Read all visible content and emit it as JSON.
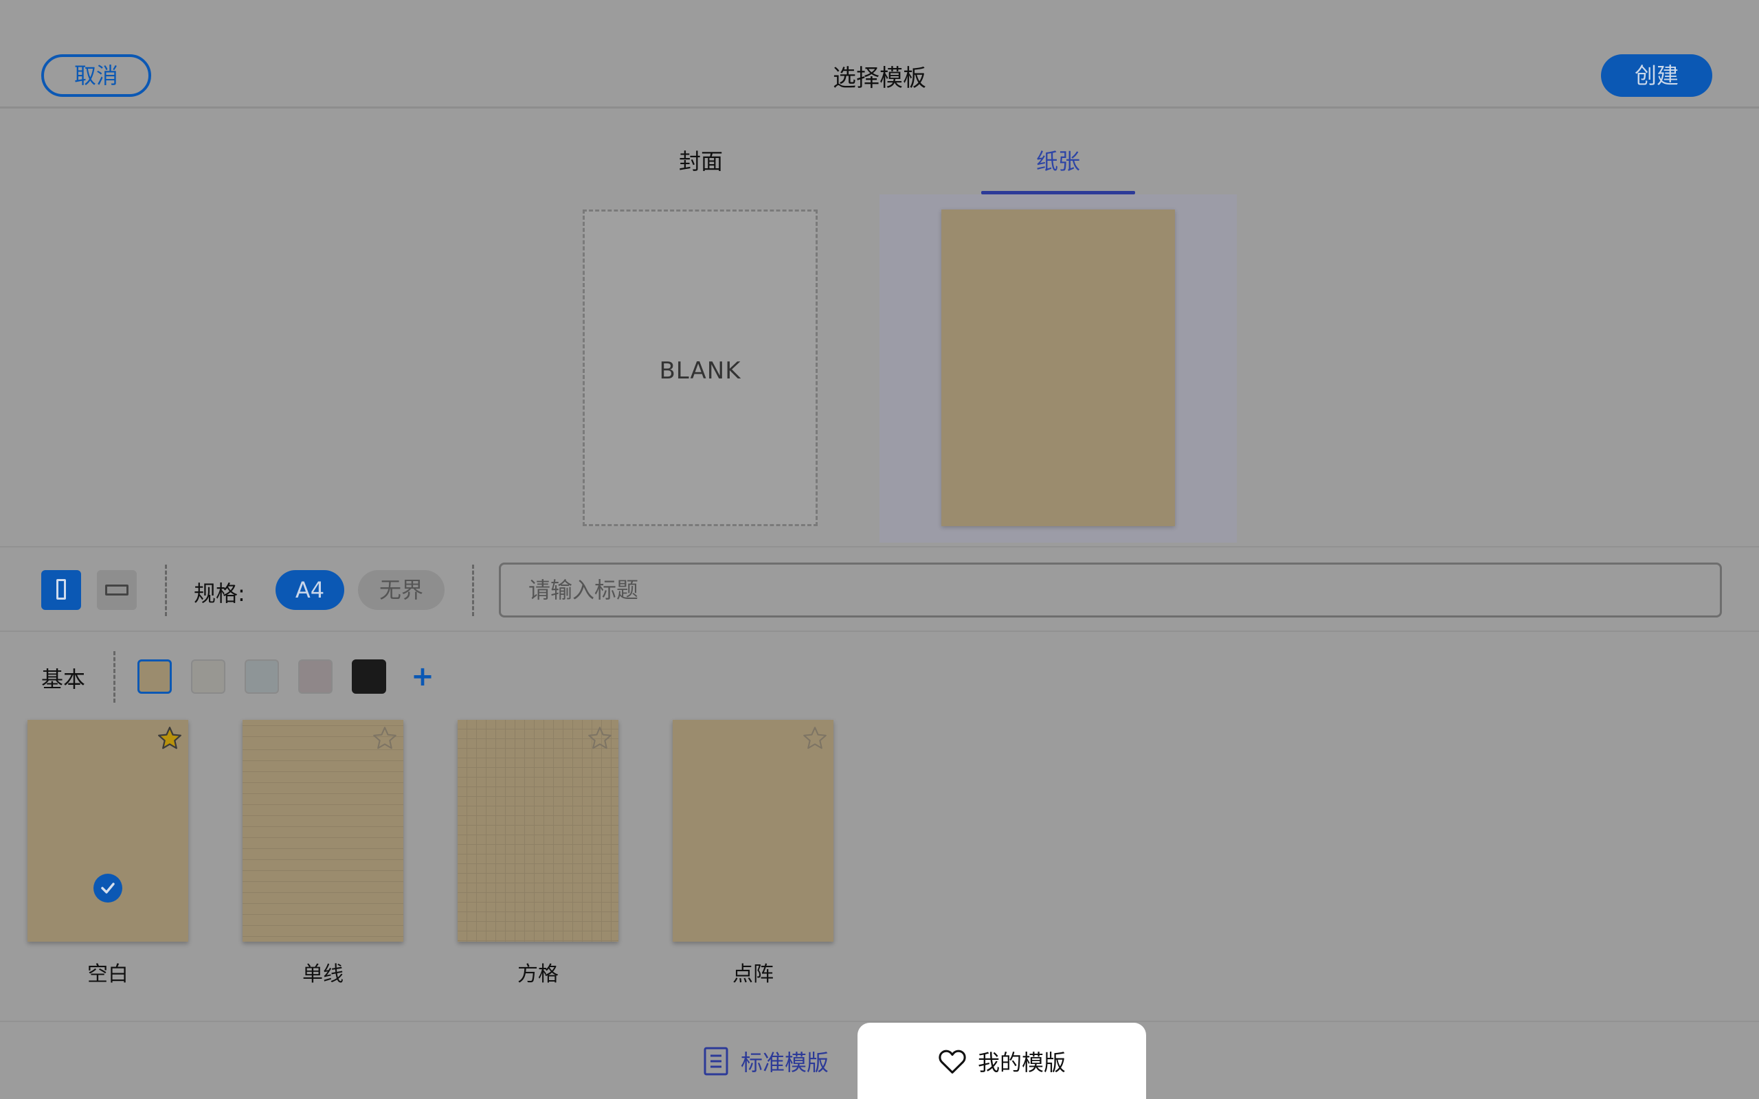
{
  "header": {
    "cancel_label": "取消",
    "title": "选择模板",
    "create_label": "创建"
  },
  "tabs": [
    {
      "label": "封面",
      "selected": false
    },
    {
      "label": "纸张",
      "selected": true
    }
  ],
  "preview": {
    "cover_text": "BLANK",
    "paper_color": "#9b8c6e"
  },
  "toolbar": {
    "orientation_selected": "portrait",
    "spec_label": "规格:",
    "spec_options": [
      "A4",
      "无界"
    ],
    "spec_selected": "A4",
    "title_input": {
      "value": "",
      "placeholder": "请输入标题"
    }
  },
  "colors": {
    "group_label": "基本",
    "swatches": [
      "#9b8c6e",
      "#989792",
      "#8e9597",
      "#8f8789",
      "#1a1a1a"
    ],
    "selected_index": 0,
    "add_label": "+",
    "accent": "#0b58b4"
  },
  "templates": [
    {
      "label": "空白",
      "favorite": true,
      "selected": true,
      "pattern": "blank"
    },
    {
      "label": "单线",
      "favorite": false,
      "selected": false,
      "pattern": "lined"
    },
    {
      "label": "方格",
      "favorite": false,
      "selected": false,
      "pattern": "grid"
    },
    {
      "label": "点阵",
      "favorite": false,
      "selected": false,
      "pattern": "dotted"
    }
  ],
  "bottom_nav": {
    "standard_label": "标准模版",
    "mine_label": "我的模版",
    "active": "mine"
  }
}
